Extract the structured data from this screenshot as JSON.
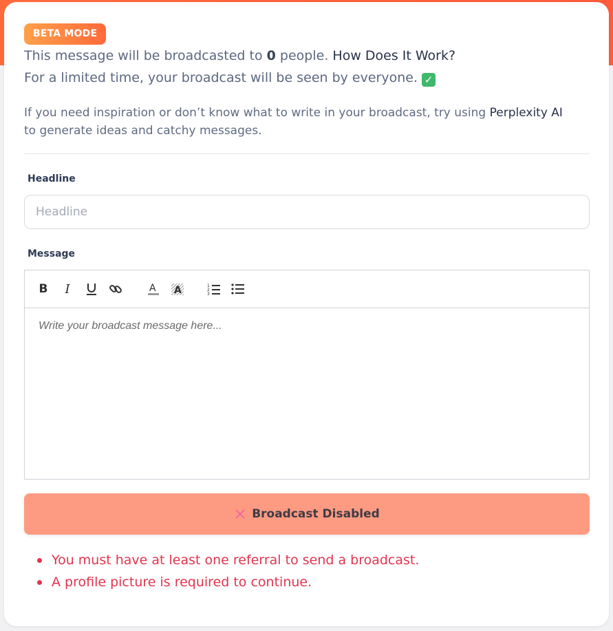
{
  "badge": "BETA MODE",
  "broadcast": {
    "text_before": "This message will be broadcasted to",
    "count": "0",
    "text_after": "people.",
    "how_link": "How Does It Work?",
    "limited_text": "For a limited time, your broadcast will be seen by everyone.",
    "check_icon": "check-mark-icon"
  },
  "tip": {
    "before": "If you need inspiration or don’t know what to write in your broadcast, try using",
    "link": "Perplexity AI",
    "after": "to generate ideas and catchy messages."
  },
  "form": {
    "headline_label": "Headline",
    "headline_placeholder": "Headline",
    "headline_value": "",
    "message_label": "Message",
    "message_placeholder": "Write your broadcast message here..."
  },
  "toolbar": {
    "items": [
      "bold-icon",
      "italic-icon",
      "underline-icon",
      "link-icon",
      "text-color-icon",
      "highlight-color-icon",
      "ordered-list-icon",
      "bullet-list-icon"
    ]
  },
  "button": {
    "label": "Broadcast Disabled",
    "icon": "x-icon",
    "color": "#fd9b82"
  },
  "errors": [
    "You must have at least one referral to send a broadcast.",
    "A profile picture is required to continue."
  ],
  "colors": {
    "accent": "#ff5a3c",
    "error": "#e2344e",
    "badge_gradient_start": "#ffa04a",
    "badge_gradient_end": "#ff6a3a"
  }
}
